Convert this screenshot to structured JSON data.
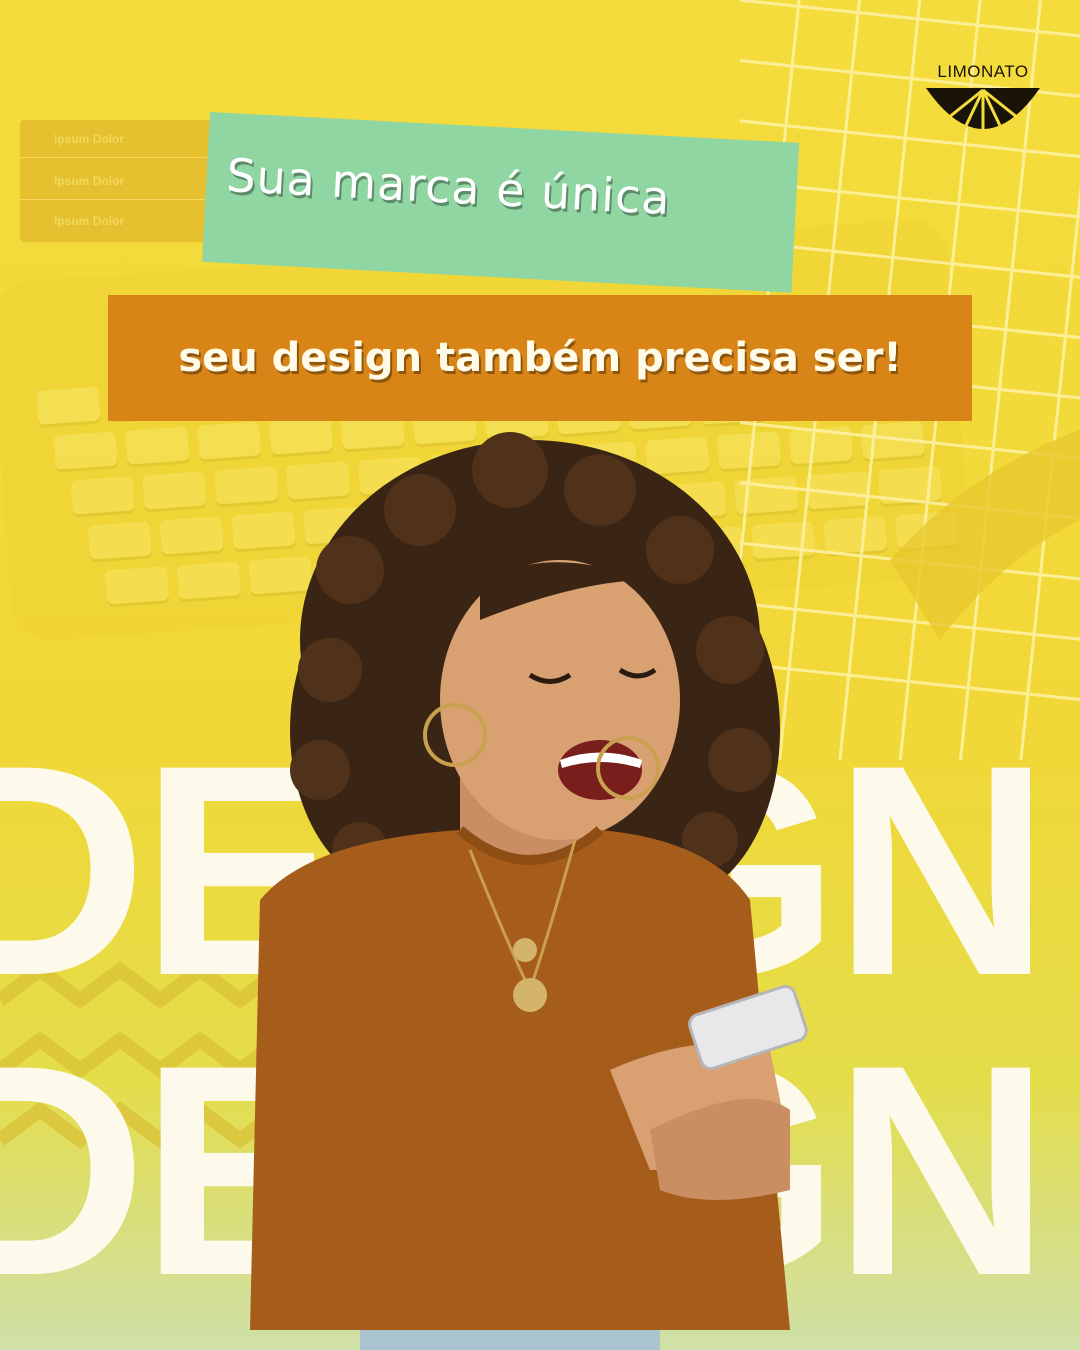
{
  "headline": {
    "line1": "Sua marca é única",
    "line2": "seu design também precisa ser!"
  },
  "brand": {
    "logo_text": "LIMONATO"
  },
  "side_panel": {
    "rows": [
      "Ipsum Dolor",
      "Ipsum Dolor",
      "Ipsum Dolor"
    ]
  },
  "big_word": {
    "line1": "DESIGN",
    "line2": "DESIGN"
  },
  "colors": {
    "background": "#f4dc3c",
    "headline1_box": "#8fd6a2",
    "headline2_box": "#d88416",
    "big_word": "#fdfaec",
    "shirt": "#a65d1c"
  },
  "photo": {
    "subject": "smiling-woman-with-phone"
  }
}
